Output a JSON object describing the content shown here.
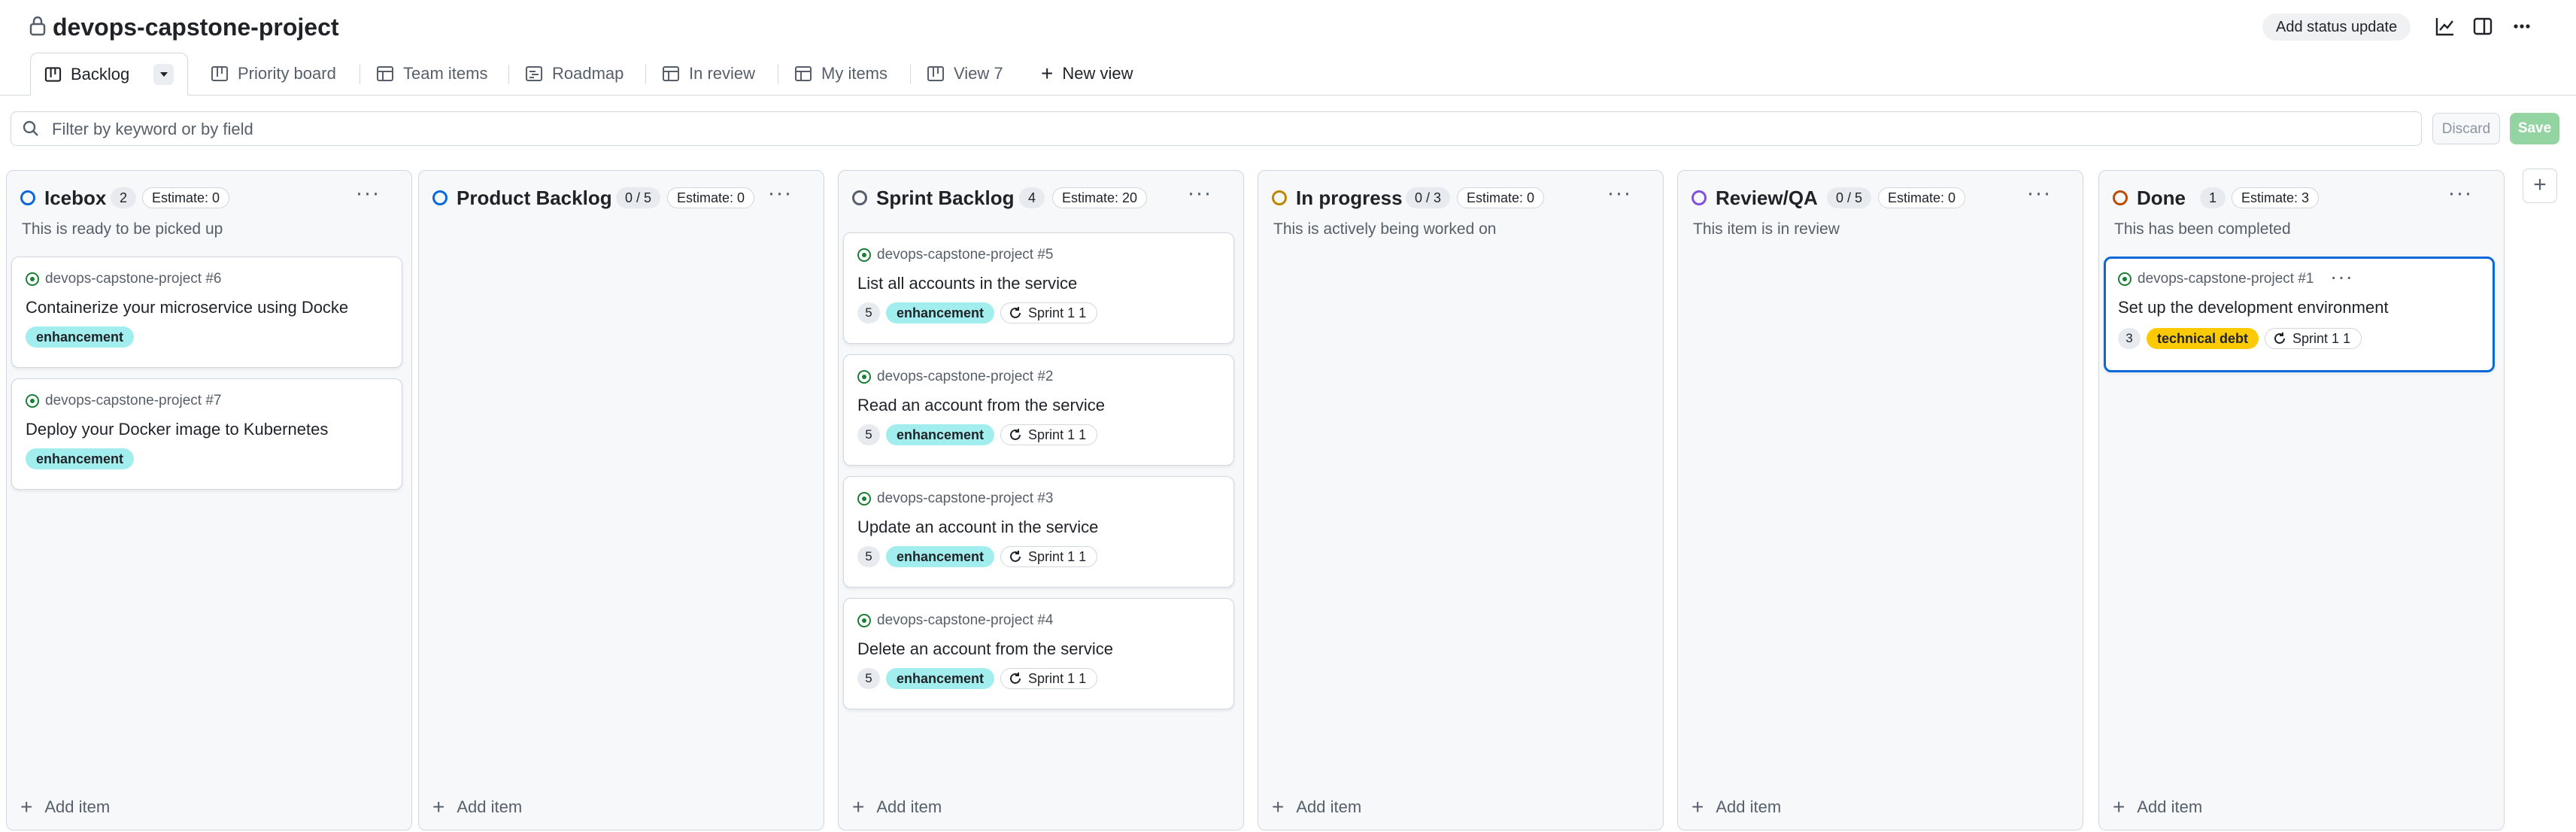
{
  "header": {
    "title": "devops-capstone-project",
    "status_update": "Add status update"
  },
  "tabs": [
    {
      "label": "Backlog"
    },
    {
      "label": "Priority board"
    },
    {
      "label": "Team items"
    },
    {
      "label": "Roadmap"
    },
    {
      "label": "In review"
    },
    {
      "label": "My items"
    },
    {
      "label": "View 7"
    },
    {
      "label": "New view"
    }
  ],
  "filter": {
    "placeholder": "Filter by keyword or by field",
    "discard": "Discard",
    "save": "Save"
  },
  "colors": {
    "accent": "#0969da",
    "enhancement": "#a2eeef",
    "technical_debt": "#fbca04",
    "issue_open": "#1a7f37"
  },
  "columns": [
    {
      "name": "Icebox",
      "count": "2",
      "estimate": "Estimate: 0",
      "description": "This is ready to be picked up",
      "status_color": "#0969da",
      "add_item": "Add item",
      "cards": [
        {
          "repo": "devops-capstone-project #6",
          "title": "Containerize your microservice using Docke",
          "label": "enhancement"
        },
        {
          "repo": "devops-capstone-project #7",
          "title": "Deploy your Docker image to Kubernetes",
          "label": "enhancement"
        }
      ]
    },
    {
      "name": "Product Backlog",
      "count": "0 / 5",
      "estimate": "Estimate: 0",
      "description": "",
      "status_color": "#0969da",
      "add_item": "Add item",
      "cards": []
    },
    {
      "name": "Sprint Backlog",
      "count": "4",
      "estimate": "Estimate: 20",
      "description": "",
      "status_color": "#57606a",
      "add_item": "Add item",
      "cards": [
        {
          "repo": "devops-capstone-project #5",
          "title": "List all accounts in the service",
          "points": "5",
          "label": "enhancement",
          "sprint": "Sprint 1 1"
        },
        {
          "repo": "devops-capstone-project #2",
          "title": "Read an account from the service",
          "points": "5",
          "label": "enhancement",
          "sprint": "Sprint 1 1"
        },
        {
          "repo": "devops-capstone-project #3",
          "title": "Update an account in the service",
          "points": "5",
          "label": "enhancement",
          "sprint": "Sprint 1 1"
        },
        {
          "repo": "devops-capstone-project #4",
          "title": "Delete an account from the service",
          "points": "5",
          "label": "enhancement",
          "sprint": "Sprint 1 1"
        }
      ]
    },
    {
      "name": "In progress",
      "count": "0 / 3",
      "estimate": "Estimate: 0",
      "description": "This is actively being worked on",
      "status_color": "#bf8700",
      "add_item": "Add item",
      "cards": []
    },
    {
      "name": "Review/QA",
      "count": "0 / 5",
      "estimate": "Estimate: 0",
      "description": "This item is in review",
      "status_color": "#8250df",
      "add_item": "Add item",
      "cards": []
    },
    {
      "name": "Done",
      "count": "1",
      "estimate": "Estimate: 3",
      "description": "This has been completed",
      "status_color": "#bc4c00",
      "add_item": "Add item",
      "cards": [
        {
          "repo": "devops-capstone-project #1",
          "title": "Set up the development environment",
          "points": "3",
          "label": "technical debt",
          "sprint": "Sprint 1 1"
        }
      ]
    }
  ]
}
